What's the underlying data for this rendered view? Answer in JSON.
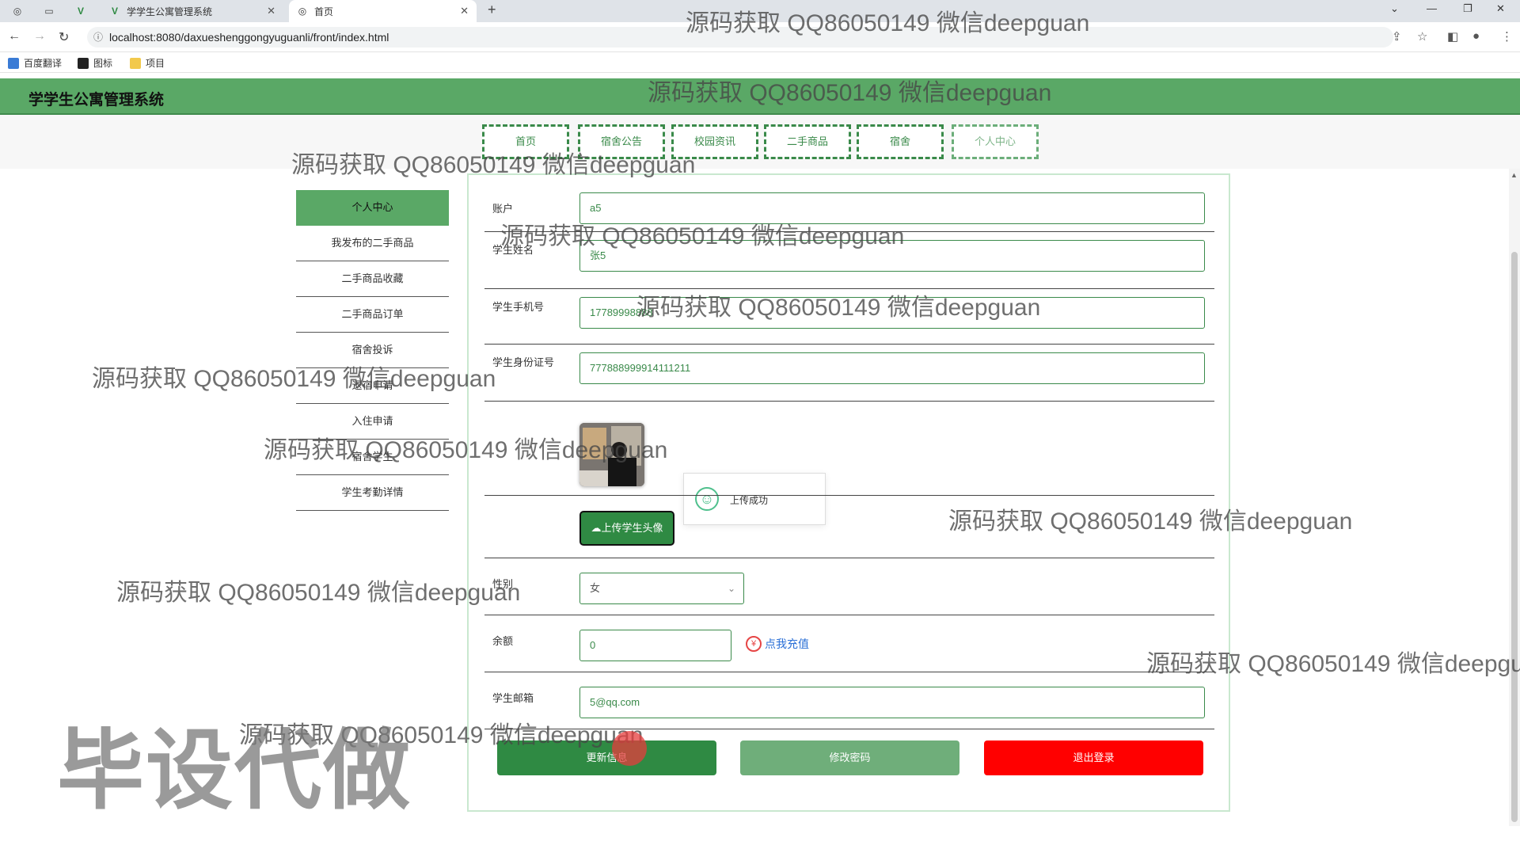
{
  "browser": {
    "tabs": [
      {
        "title": "学学生公寓管理系统",
        "active": false
      },
      {
        "title": "首页",
        "active": true
      }
    ],
    "url": "localhost:8080/daxueshenggongyuguanli/front/index.html",
    "bookmarks": [
      "百度翻译",
      "图标",
      "项目"
    ]
  },
  "site": {
    "title": "学学生公寓管理系统",
    "nav": [
      "首页",
      "宿舍公告",
      "校园资讯",
      "二手商品",
      "宿舍",
      "个人中心"
    ]
  },
  "sidebar": {
    "items": [
      "个人中心",
      "我发布的二手商品",
      "二手商品收藏",
      "二手商品订单",
      "宿舍投诉",
      "退宿申请",
      "入住申请",
      "宿舍学生",
      "学生考勤详情"
    ],
    "active_index": 0
  },
  "form": {
    "account_label": "账户",
    "account_value": "a5",
    "name_label": "学生姓名",
    "name_value": "张5",
    "phone_label": "学生手机号",
    "phone_value": "17789998888",
    "idcard_label": "学生身份证号",
    "idcard_value": "777888999914111211",
    "upload_button": "上传学生头像",
    "toast_message": "上传成功",
    "gender_label": "性别",
    "gender_value": "女",
    "balance_label": "余额",
    "balance_value": "0",
    "recharge_link": "点我充值",
    "email_label": "学生邮箱",
    "email_value": "5@qq.com",
    "update_button": "更新信息",
    "password_button": "修改密码",
    "logout_button": "退出登录"
  },
  "watermark": {
    "text": "源码获取 QQ86050149 微信deepguan",
    "big_text": "毕设代做"
  },
  "colors": {
    "header_green": "#5aa866",
    "dark_green": "#2f8a43",
    "muted_green": "#6fae7a",
    "danger_red": "#ff0000",
    "link_blue": "#2a6fd6"
  }
}
